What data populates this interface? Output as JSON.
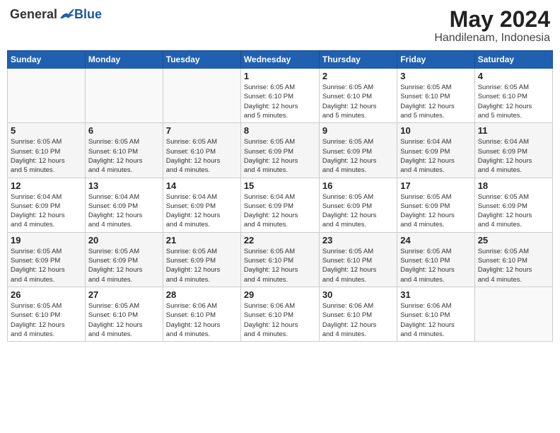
{
  "header": {
    "logo": {
      "general": "General",
      "blue": "Blue"
    },
    "title": "May 2024",
    "location": "Handilenam, Indonesia"
  },
  "calendar": {
    "weekdays": [
      "Sunday",
      "Monday",
      "Tuesday",
      "Wednesday",
      "Thursday",
      "Friday",
      "Saturday"
    ],
    "weeks": [
      [
        {
          "day": "",
          "info": ""
        },
        {
          "day": "",
          "info": ""
        },
        {
          "day": "",
          "info": ""
        },
        {
          "day": "1",
          "info": "Sunrise: 6:05 AM\nSunset: 6:10 PM\nDaylight: 12 hours\nand 5 minutes."
        },
        {
          "day": "2",
          "info": "Sunrise: 6:05 AM\nSunset: 6:10 PM\nDaylight: 12 hours\nand 5 minutes."
        },
        {
          "day": "3",
          "info": "Sunrise: 6:05 AM\nSunset: 6:10 PM\nDaylight: 12 hours\nand 5 minutes."
        },
        {
          "day": "4",
          "info": "Sunrise: 6:05 AM\nSunset: 6:10 PM\nDaylight: 12 hours\nand 5 minutes."
        }
      ],
      [
        {
          "day": "5",
          "info": "Sunrise: 6:05 AM\nSunset: 6:10 PM\nDaylight: 12 hours\nand 5 minutes."
        },
        {
          "day": "6",
          "info": "Sunrise: 6:05 AM\nSunset: 6:10 PM\nDaylight: 12 hours\nand 4 minutes."
        },
        {
          "day": "7",
          "info": "Sunrise: 6:05 AM\nSunset: 6:10 PM\nDaylight: 12 hours\nand 4 minutes."
        },
        {
          "day": "8",
          "info": "Sunrise: 6:05 AM\nSunset: 6:09 PM\nDaylight: 12 hours\nand 4 minutes."
        },
        {
          "day": "9",
          "info": "Sunrise: 6:05 AM\nSunset: 6:09 PM\nDaylight: 12 hours\nand 4 minutes."
        },
        {
          "day": "10",
          "info": "Sunrise: 6:04 AM\nSunset: 6:09 PM\nDaylight: 12 hours\nand 4 minutes."
        },
        {
          "day": "11",
          "info": "Sunrise: 6:04 AM\nSunset: 6:09 PM\nDaylight: 12 hours\nand 4 minutes."
        }
      ],
      [
        {
          "day": "12",
          "info": "Sunrise: 6:04 AM\nSunset: 6:09 PM\nDaylight: 12 hours\nand 4 minutes."
        },
        {
          "day": "13",
          "info": "Sunrise: 6:04 AM\nSunset: 6:09 PM\nDaylight: 12 hours\nand 4 minutes."
        },
        {
          "day": "14",
          "info": "Sunrise: 6:04 AM\nSunset: 6:09 PM\nDaylight: 12 hours\nand 4 minutes."
        },
        {
          "day": "15",
          "info": "Sunrise: 6:04 AM\nSunset: 6:09 PM\nDaylight: 12 hours\nand 4 minutes."
        },
        {
          "day": "16",
          "info": "Sunrise: 6:05 AM\nSunset: 6:09 PM\nDaylight: 12 hours\nand 4 minutes."
        },
        {
          "day": "17",
          "info": "Sunrise: 6:05 AM\nSunset: 6:09 PM\nDaylight: 12 hours\nand 4 minutes."
        },
        {
          "day": "18",
          "info": "Sunrise: 6:05 AM\nSunset: 6:09 PM\nDaylight: 12 hours\nand 4 minutes."
        }
      ],
      [
        {
          "day": "19",
          "info": "Sunrise: 6:05 AM\nSunset: 6:09 PM\nDaylight: 12 hours\nand 4 minutes."
        },
        {
          "day": "20",
          "info": "Sunrise: 6:05 AM\nSunset: 6:09 PM\nDaylight: 12 hours\nand 4 minutes."
        },
        {
          "day": "21",
          "info": "Sunrise: 6:05 AM\nSunset: 6:09 PM\nDaylight: 12 hours\nand 4 minutes."
        },
        {
          "day": "22",
          "info": "Sunrise: 6:05 AM\nSunset: 6:10 PM\nDaylight: 12 hours\nand 4 minutes."
        },
        {
          "day": "23",
          "info": "Sunrise: 6:05 AM\nSunset: 6:10 PM\nDaylight: 12 hours\nand 4 minutes."
        },
        {
          "day": "24",
          "info": "Sunrise: 6:05 AM\nSunset: 6:10 PM\nDaylight: 12 hours\nand 4 minutes."
        },
        {
          "day": "25",
          "info": "Sunrise: 6:05 AM\nSunset: 6:10 PM\nDaylight: 12 hours\nand 4 minutes."
        }
      ],
      [
        {
          "day": "26",
          "info": "Sunrise: 6:05 AM\nSunset: 6:10 PM\nDaylight: 12 hours\nand 4 minutes."
        },
        {
          "day": "27",
          "info": "Sunrise: 6:05 AM\nSunset: 6:10 PM\nDaylight: 12 hours\nand 4 minutes."
        },
        {
          "day": "28",
          "info": "Sunrise: 6:06 AM\nSunset: 6:10 PM\nDaylight: 12 hours\nand 4 minutes."
        },
        {
          "day": "29",
          "info": "Sunrise: 6:06 AM\nSunset: 6:10 PM\nDaylight: 12 hours\nand 4 minutes."
        },
        {
          "day": "30",
          "info": "Sunrise: 6:06 AM\nSunset: 6:10 PM\nDaylight: 12 hours\nand 4 minutes."
        },
        {
          "day": "31",
          "info": "Sunrise: 6:06 AM\nSunset: 6:10 PM\nDaylight: 12 hours\nand 4 minutes."
        },
        {
          "day": "",
          "info": ""
        }
      ]
    ]
  }
}
